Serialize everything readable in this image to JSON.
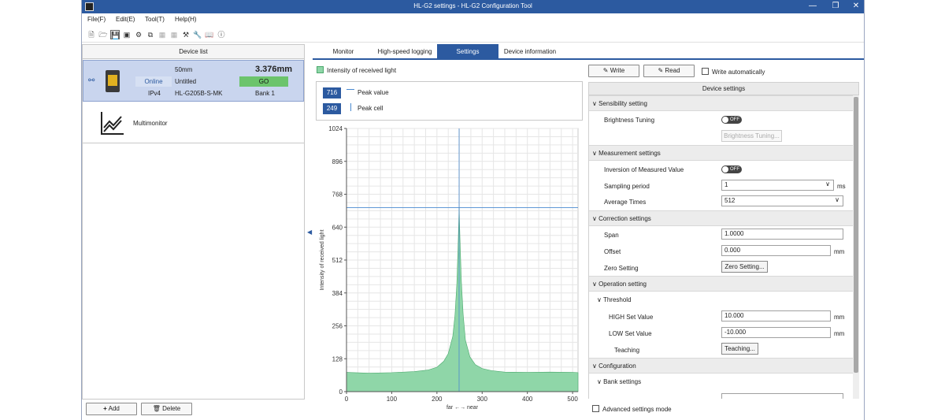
{
  "window": {
    "title": "HL-G2 settings - HL-G2 Configuration Tool"
  },
  "menu": [
    "File(F)",
    "Edit(E)",
    "Tool(T)",
    "Help(H)"
  ],
  "toolbar_icons": [
    "new-file-icon",
    "open-folder-icon",
    "save-icon",
    "save-as-icon",
    "connect-icon",
    "copy-icon",
    "paste-icon",
    "compare-icon",
    "tools-icon",
    "manual-icon",
    "info-icon"
  ],
  "device_list": {
    "header": "Device list",
    "device": {
      "range": "50mm",
      "measurement": "3.376mm",
      "status": "Online",
      "name": "Untitled",
      "judgement": "GO",
      "protocol": "IPv4",
      "model": "HL-G205B-S-MK",
      "bank": "Bank 1"
    },
    "multimonitor": "Multimonitor",
    "add_label": "Add",
    "delete_label": "Delete"
  },
  "tabs": [
    "Monitor",
    "High-speed logging",
    "Settings",
    "Device information"
  ],
  "active_tab": "Settings",
  "graph": {
    "legend": "Intensity of received light",
    "peak_value": "716",
    "peak_value_label": "Peak value",
    "peak_cell": "249",
    "peak_cell_label": "Peak cell"
  },
  "chart_data": {
    "type": "area",
    "ylabel": "Intensity of received light",
    "xlabel": "far ←→ near",
    "xlim": [
      0,
      512
    ],
    "ylim": [
      0,
      1024
    ],
    "xticks": [
      0,
      100,
      200,
      300,
      400,
      500
    ],
    "yticks": [
      0,
      128,
      256,
      384,
      512,
      640,
      768,
      896,
      1024
    ],
    "grid": true,
    "color": "#8fd6a8",
    "peak_value": 716,
    "peak_cell": 249,
    "x": [
      0,
      50,
      100,
      150,
      180,
      200,
      215,
      225,
      235,
      240,
      244,
      247,
      249,
      251,
      254,
      258,
      263,
      273,
      285,
      300,
      320,
      350,
      400,
      450,
      500,
      512
    ],
    "y": [
      75,
      72,
      74,
      78,
      84,
      95,
      118,
      148,
      215,
      300,
      420,
      580,
      716,
      590,
      430,
      300,
      200,
      135,
      105,
      90,
      82,
      76,
      75,
      76,
      75,
      74
    ]
  },
  "settings": {
    "write_label": "Write",
    "read_label": "Read",
    "write_auto_label": "Write automatically",
    "header": "Device settings",
    "sections": {
      "sensibility": "Sensibility setting",
      "measurement": "Measurement settings",
      "correction": "Correction settings",
      "operation": "Operation setting",
      "configuration": "Configuration"
    },
    "subsections": {
      "threshold": "Threshold",
      "bank": "Bank settings"
    },
    "brightness_tuning_label": "Brightness Tuning",
    "brightness_toggle": "OFF",
    "brightness_button": "Brightness Tuning...",
    "inversion_label": "Inversion of Measured Value",
    "inversion_toggle": "OFF",
    "sampling_label": "Sampling period",
    "sampling_value": "1",
    "sampling_unit": "ms",
    "average_label": "Average Times",
    "average_value": "512",
    "span_label": "Span",
    "span_value": "1.0000",
    "offset_label": "Offset",
    "offset_value": "0.000",
    "offset_unit": "mm",
    "zero_label": "Zero Setting",
    "zero_button": "Zero Setting...",
    "high_label": "HIGH Set Value",
    "high_value": "10.000",
    "high_unit": "mm",
    "low_label": "LOW Set Value",
    "low_value": "-10.000",
    "low_unit": "mm",
    "teaching_label": "Teaching",
    "teaching_button": "Teaching...",
    "advanced_label": "Advanced settings mode"
  }
}
